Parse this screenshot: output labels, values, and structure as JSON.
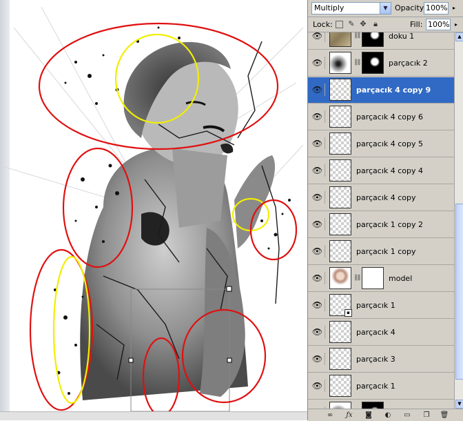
{
  "layers_panel": {
    "blend_mode": "Multiply",
    "opacity_label": "Opacity:",
    "opacity_value": "100%",
    "lock_label": "Lock:",
    "fill_label": "Fill:",
    "fill_value": "100%",
    "layers": [
      {
        "name": "doku 1",
        "thumb": "texture",
        "mask": "dark",
        "selected": false
      },
      {
        "name": "parçacık 2",
        "thumb": "spatter",
        "mask": "dark",
        "selected": false
      },
      {
        "name": "parçacık 4 copy 9",
        "thumb": "transparent",
        "mask": null,
        "selected": true
      },
      {
        "name": "parçacık 4 copy 6",
        "thumb": "transparent",
        "mask": null,
        "selected": false
      },
      {
        "name": "parçacık 4 copy 5",
        "thumb": "transparent",
        "mask": null,
        "selected": false
      },
      {
        "name": "parçacık 4 copy 4",
        "thumb": "transparent",
        "mask": null,
        "selected": false
      },
      {
        "name": "parçacık 4 copy",
        "thumb": "transparent",
        "mask": null,
        "selected": false
      },
      {
        "name": "parçacık 1 copy 2",
        "thumb": "transparent",
        "mask": null,
        "selected": false
      },
      {
        "name": "parçacık 1 copy",
        "thumb": "transparent",
        "mask": null,
        "selected": false
      },
      {
        "name": "model",
        "thumb": "photo",
        "mask": "white",
        "selected": false
      },
      {
        "name": "parçacık 1",
        "thumb": "transparent",
        "mask": null,
        "selected": false,
        "smart": true
      },
      {
        "name": "parçacık 4",
        "thumb": "transparent",
        "mask": null,
        "selected": false
      },
      {
        "name": "parçacık 3",
        "thumb": "transparent",
        "mask": null,
        "selected": false
      },
      {
        "name": "parçacık 1",
        "thumb": "transparent",
        "mask": null,
        "selected": false
      },
      {
        "name": "",
        "thumb": "spatter",
        "mask": "dark",
        "selected": false
      }
    ],
    "bottom_icons": [
      "link-icon",
      "fx-icon",
      "mask-icon",
      "adjustment-icon",
      "folder-icon",
      "new-layer-icon",
      "trash-icon"
    ],
    "selected_color": "#316ac5"
  },
  "canvas": {
    "annotation_colors": {
      "red": "#e01010",
      "yellow": "#f2ee00"
    }
  }
}
